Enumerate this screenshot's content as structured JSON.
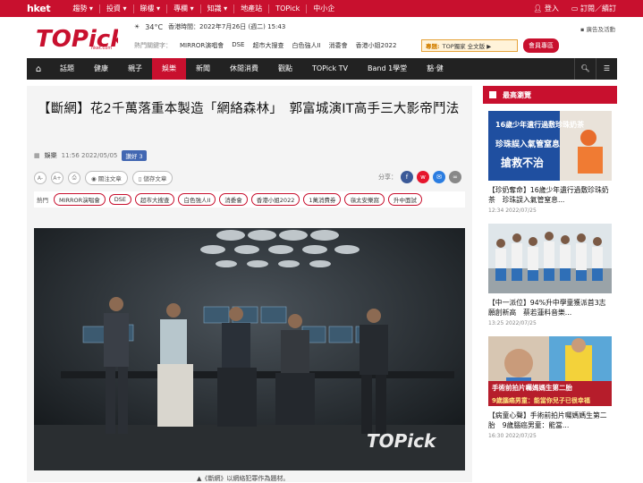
{
  "topbar": {
    "logo": "hket",
    "nav": [
      "趨勢 ▾",
      "投資 ▾",
      "睇樓 ▾",
      "專欄 ▾",
      "知識 ▾",
      "地產站",
      "TOPick",
      "中小企"
    ],
    "login": "登入",
    "subscribe": "訂閱／續訂"
  },
  "header": {
    "brand_text": "TOPick",
    "brand_sub": "hket.com",
    "temp": "34°C",
    "time": "香港時間：2022年7月26日 (週二) 15:43",
    "hot_label": "熱門關鍵字：",
    "hot_items": [
      "MIRROR演唱會",
      "DSE",
      "超市大搜查",
      "白色強人II",
      "消委會",
      "香港小姐2022"
    ],
    "promo_tag": "專題:",
    "promo_text": "TOP獨家 全文版 ▶",
    "member": "會員專區",
    "adlink": "廣告及活動"
  },
  "mainnav": {
    "items": [
      "話題",
      "健康",
      "親子",
      "娛樂",
      "新聞",
      "休閒消費",
      "觀點",
      "TOPick TV",
      "Band 1學堂",
      "豁·健"
    ],
    "active": "娛樂"
  },
  "article": {
    "headline": "【斷網】花2千萬落重本製造「網絡森林」　郭富城演IT高手三大影帝鬥法",
    "category": "娛樂",
    "timestamp": "11:56 2022/05/05",
    "like_label": "讚好 3",
    "font_small": "A-",
    "font_large": "A+",
    "print": "⎙",
    "follow": "關注文章",
    "save": "儲存文章",
    "share_label": "分享：",
    "tags_label": "熱門",
    "tags": [
      "MIRROR演唱會",
      "DSE",
      "超市大搜查",
      "白色強人II",
      "消委會",
      "香港小姐2022",
      "1萬消費券",
      "嶺太安樂窩",
      "升中面試"
    ],
    "photo_watermark": "TOPick",
    "caption": "▲《斷網》以網絡犯罪作為題材。"
  },
  "sidebar": {
    "title": "最高瀏覽",
    "items": [
      {
        "title": "【珍奶奪命】16歲少年遺行過敷珍珠奶茶　珍珠誤入氣管窒息...",
        "date": "12:34 2022/07/25",
        "thumb_text": "16歲少年遺行過敷珍珠奶茶",
        "thumb_sub": "珍珠誤入氣管窒息",
        "thumb_sub2": "搶救不治"
      },
      {
        "title": "【中一派位】94%升中學童獲派首3志願創新高　蔡若蓮料音樂...",
        "date": "13:25 2022/07/25",
        "thumb_text": "",
        "thumb_sub": "",
        "thumb_sub2": ""
      },
      {
        "title": "【病童心聲】手術前拍片囑媽媽生第二胎　9歲腦癌男童：能當...",
        "date": "16:30 2022/07/25",
        "thumb_text": "手術前拍片囑媽媽生第二胎",
        "thumb_sub": "9歲腦癌男童：能當你兒子已很幸福",
        "thumb_sub2": ""
      }
    ]
  }
}
